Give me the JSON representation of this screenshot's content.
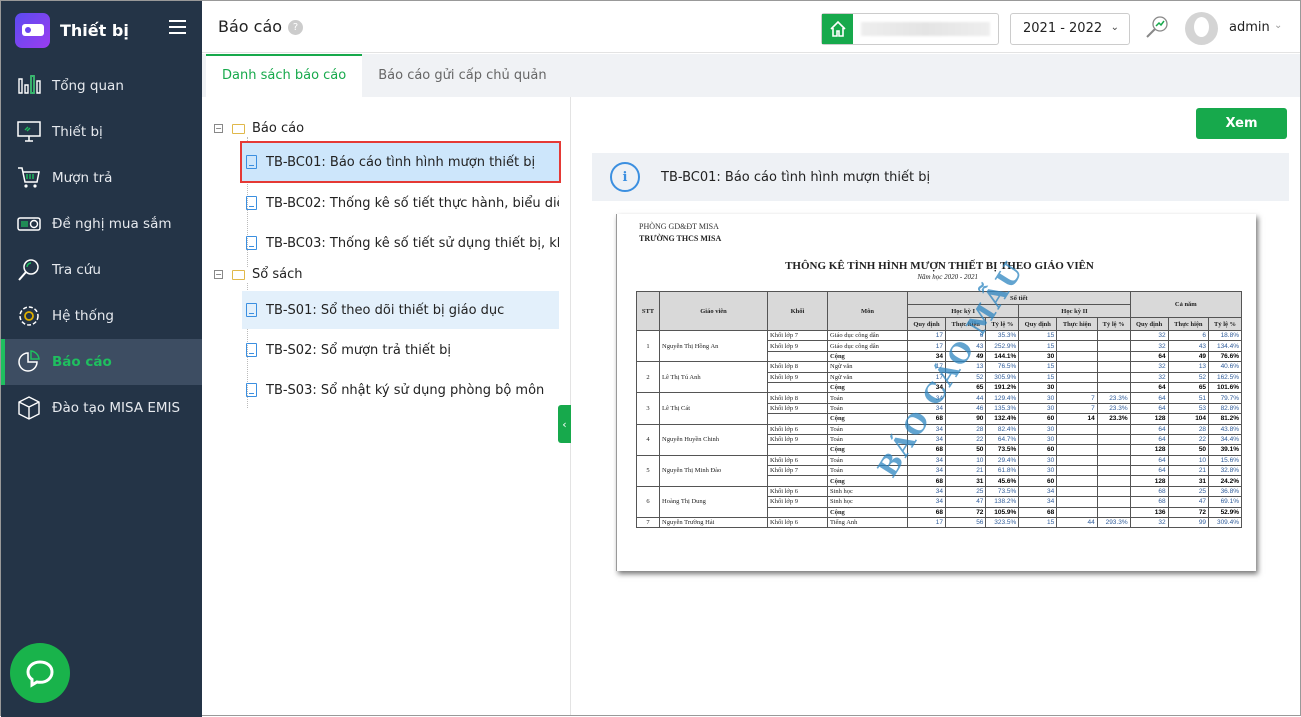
{
  "app": {
    "title": "Thiết bị"
  },
  "sidebar": {
    "items": [
      {
        "label": "Tổng quan",
        "icon": "bar-chart-icon"
      },
      {
        "label": "Thiết bị",
        "icon": "monitor-icon"
      },
      {
        "label": "Mượn trả",
        "icon": "cart-icon"
      },
      {
        "label": "Đề nghị mua sắm",
        "icon": "projector-icon"
      },
      {
        "label": "Tra cứu",
        "icon": "search-icon"
      },
      {
        "label": "Hệ thống",
        "icon": "gear-icon"
      },
      {
        "label": "Báo cáo",
        "icon": "pie-chart-icon",
        "active": true
      },
      {
        "label": "Đào tạo MISA EMIS",
        "icon": "cube-icon"
      }
    ]
  },
  "header": {
    "title": "Báo cáo",
    "help": "?",
    "year": "2021 - 2022",
    "user": "admin"
  },
  "tabs": [
    {
      "label": "Danh sách báo cáo",
      "active": true
    },
    {
      "label": "Báo cáo gửi cấp chủ quản"
    }
  ],
  "tree": {
    "groups": [
      {
        "label": "Báo cáo",
        "toggle": "−",
        "items": [
          "TB-BC01: Báo cáo tình hình mượn thiết bị",
          "TB-BC02: Thống kê số tiết thực hành, biểu diễ...",
          "TB-BC03: Thống kê số tiết sử dụng thiết bị, kh..."
        ]
      },
      {
        "label": "Sổ sách",
        "toggle": "−",
        "items": [
          "TB-S01: Sổ theo dõi thiết bị giáo dục",
          "TB-S02: Sổ mượn trả thiết bị",
          "TB-S03: Sổ nhật ký sử dụng phòng bộ môn"
        ]
      }
    ]
  },
  "viewer": {
    "view_button": "Xem",
    "info": "TB-BC01: Báo cáo tình hình mượn thiết bị"
  },
  "report": {
    "org1": "PHÒNG GD&ĐT MISA",
    "org2": "TRƯỜNG THCS MISA",
    "title": "THÔNG KÊ TÌNH HÌNH MƯỢN THIẾT BỊ THEO GIÁO VIÊN",
    "year": "Năm học 2020 - 2021",
    "watermark": "BÁO CÁO MẪU",
    "headers": {
      "stt": "STT",
      "teacher": "Giáo viên",
      "grade": "Khối",
      "subject": "Môn",
      "periods": "Số tiết",
      "sem1": "Học kỳ I",
      "sem2": "Học kỳ II",
      "year": "Cả năm",
      "planned": "Quy định",
      "actual": "Thực hiện",
      "ratio": "Tỷ lệ %"
    },
    "sum_label": "Cộng",
    "teachers": [
      {
        "stt": "1",
        "name": "Nguyễn Thị Hồng An",
        "rows": [
          [
            "Khối lớp 7",
            "Giáo dục công dân",
            "17",
            "6",
            "35.3%",
            "15",
            "",
            "",
            "32",
            "6",
            "18.8%"
          ],
          [
            "Khối lớp 9",
            "Giáo dục công dân",
            "17",
            "43",
            "252.9%",
            "15",
            "",
            "",
            "32",
            "43",
            "134.4%"
          ]
        ],
        "sum": [
          "34",
          "49",
          "144.1%",
          "30",
          "",
          "",
          "64",
          "49",
          "76.6%"
        ]
      },
      {
        "stt": "2",
        "name": "Lê Thị Tú Anh",
        "rows": [
          [
            "Khối lớp 8",
            "Ngữ văn",
            "17",
            "13",
            "76.5%",
            "15",
            "",
            "",
            "32",
            "13",
            "40.6%"
          ],
          [
            "Khối lớp 9",
            "Ngữ văn",
            "17",
            "52",
            "305.9%",
            "15",
            "",
            "",
            "32",
            "52",
            "162.5%"
          ]
        ],
        "sum": [
          "34",
          "65",
          "191.2%",
          "30",
          "",
          "",
          "64",
          "65",
          "101.6%"
        ]
      },
      {
        "stt": "3",
        "name": "Lê Thị Cát",
        "rows": [
          [
            "Khối lớp 8",
            "Toán",
            "34",
            "44",
            "129.4%",
            "30",
            "7",
            "23.3%",
            "64",
            "51",
            "79.7%"
          ],
          [
            "Khối lớp 9",
            "Toán",
            "34",
            "46",
            "135.3%",
            "30",
            "7",
            "23.3%",
            "64",
            "53",
            "82.8%"
          ]
        ],
        "sum": [
          "68",
          "90",
          "132.4%",
          "60",
          "14",
          "23.3%",
          "128",
          "104",
          "81.2%"
        ]
      },
      {
        "stt": "4",
        "name": "Nguyễn Huyền Chinh",
        "rows": [
          [
            "Khối lớp 6",
            "Toán",
            "34",
            "28",
            "82.4%",
            "30",
            "",
            "",
            "64",
            "28",
            "43.8%"
          ],
          [
            "Khối lớp 9",
            "Toán",
            "34",
            "22",
            "64.7%",
            "30",
            "",
            "",
            "64",
            "22",
            "34.4%"
          ]
        ],
        "sum": [
          "68",
          "50",
          "73.5%",
          "60",
          "",
          "",
          "128",
          "50",
          "39.1%"
        ]
      },
      {
        "stt": "5",
        "name": "Nguyễn Thị Minh Đào",
        "rows": [
          [
            "Khối lớp 6",
            "Toán",
            "34",
            "10",
            "29.4%",
            "30",
            "",
            "",
            "64",
            "10",
            "15.6%"
          ],
          [
            "Khối lớp 7",
            "Toán",
            "34",
            "21",
            "61.8%",
            "30",
            "",
            "",
            "64",
            "21",
            "32.8%"
          ]
        ],
        "sum": [
          "68",
          "31",
          "45.6%",
          "60",
          "",
          "",
          "128",
          "31",
          "24.2%"
        ]
      },
      {
        "stt": "6",
        "name": "Hoàng Thị Dung",
        "rows": [
          [
            "Khối lớp 6",
            "Sinh học",
            "34",
            "25",
            "73.5%",
            "34",
            "",
            "",
            "68",
            "25",
            "36.8%"
          ],
          [
            "Khối lớp 9",
            "Sinh học",
            "34",
            "47",
            "138.2%",
            "34",
            "",
            "",
            "68",
            "47",
            "69.1%"
          ]
        ],
        "sum": [
          "68",
          "72",
          "105.9%",
          "68",
          "",
          "",
          "136",
          "72",
          "52.9%"
        ]
      },
      {
        "stt": "7",
        "name": "Nguyễn Trường Hải",
        "rows": [
          [
            "Khối lớp 6",
            "Tiếng Anh",
            "17",
            "56",
            "323.5%",
            "15",
            "44",
            "293.3%",
            "32",
            "99",
            "309.4%"
          ]
        ]
      }
    ]
  },
  "colors": {
    "sidebar": "#243447",
    "accent": "#17a94c",
    "selection": "#d9ecfb"
  }
}
